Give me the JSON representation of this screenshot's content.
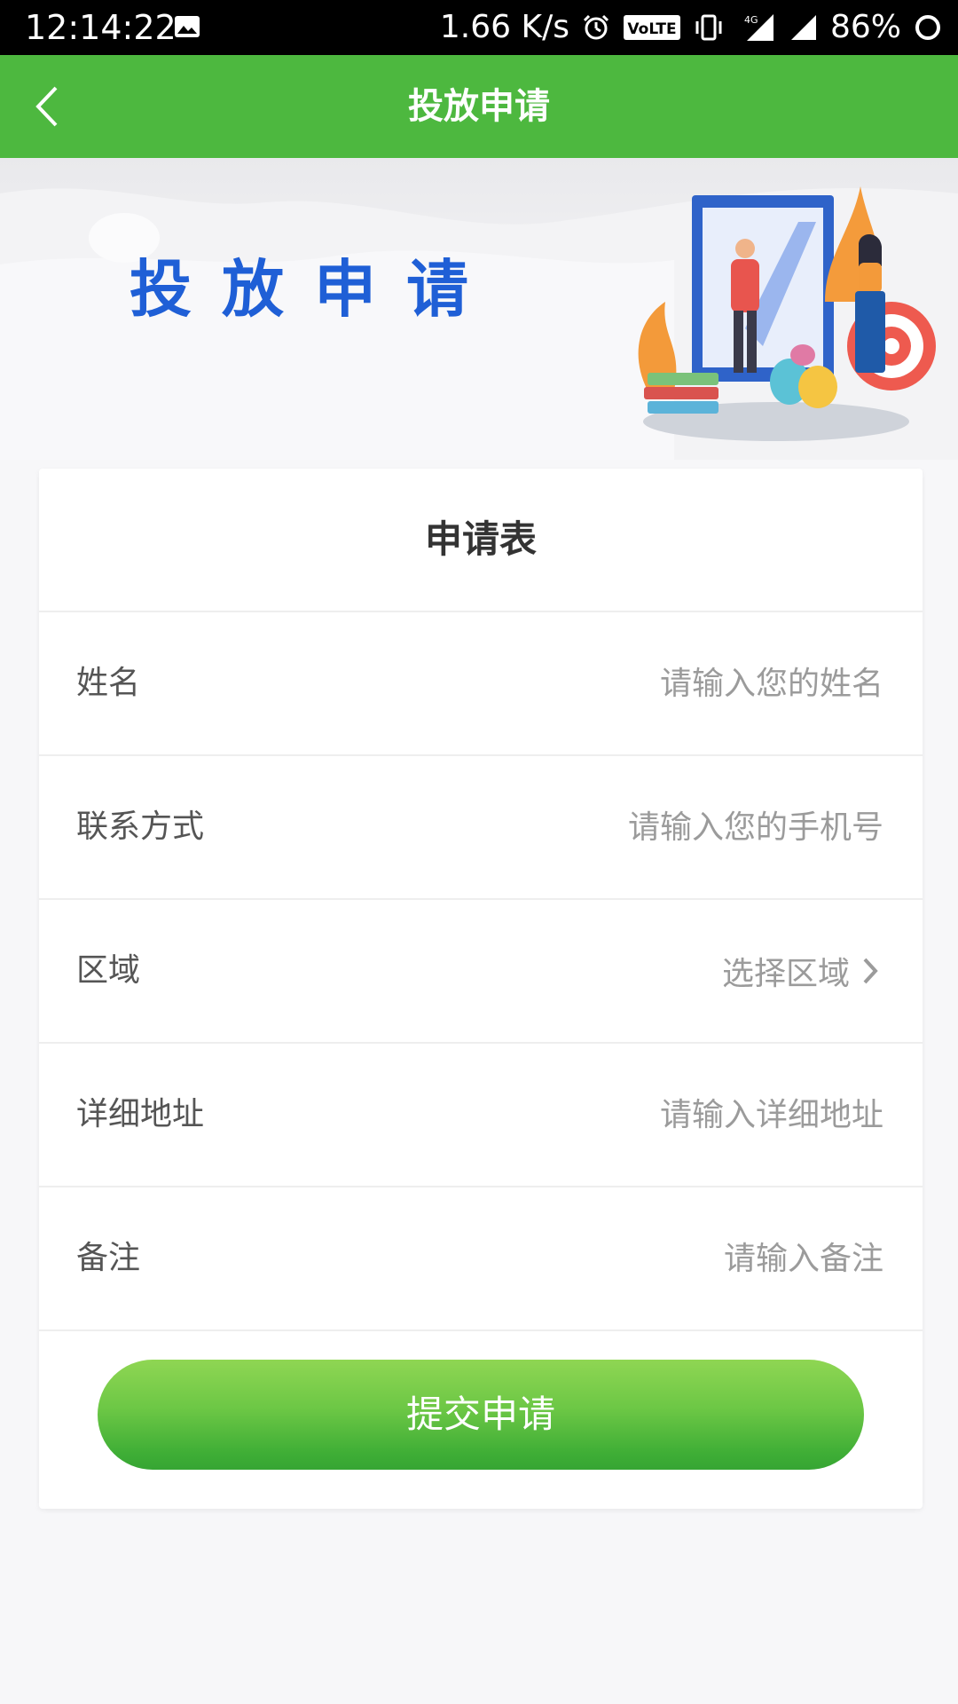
{
  "status_bar": {
    "time": "12:14:22",
    "net_speed": "1.66 K/s",
    "volte": "VoLTE",
    "network": "4G",
    "battery": "86%"
  },
  "header": {
    "title": "投放申请",
    "back_icon": "chevron-left-icon"
  },
  "banner": {
    "title": "投放申请",
    "title_color": "#1f5fd6"
  },
  "form": {
    "title": "申请表",
    "fields": [
      {
        "label": "姓名",
        "placeholder": "请输入您的姓名",
        "value": ""
      },
      {
        "label": "联系方式",
        "placeholder": "请输入您的手机号",
        "value": ""
      },
      {
        "label": "区域",
        "select_text": "选择区域"
      },
      {
        "label": "详细地址",
        "placeholder": "请输入详细地址",
        "value": ""
      },
      {
        "label": "备注",
        "placeholder": "请输入备注",
        "value": ""
      }
    ],
    "submit_label": "提交申请"
  },
  "colors": {
    "header_green": "#4db83f",
    "button_green_top": "#8fd653",
    "button_green_bottom": "#36a533",
    "text_primary": "#333333",
    "placeholder": "#9b9b9b"
  }
}
